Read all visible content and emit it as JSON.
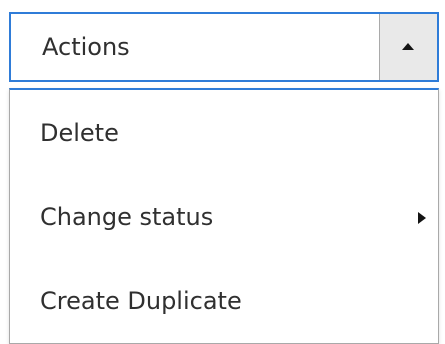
{
  "actions_dropdown": {
    "label": "Actions",
    "toggle_icon": "caret-up-icon",
    "accent_color": "#2f7cd8",
    "menu": {
      "items": [
        {
          "label": "Delete"
        },
        {
          "label": "Change status",
          "has_submenu": true,
          "submenu_icon": "caret-right-icon"
        },
        {
          "label": "Create Duplicate"
        }
      ]
    }
  }
}
